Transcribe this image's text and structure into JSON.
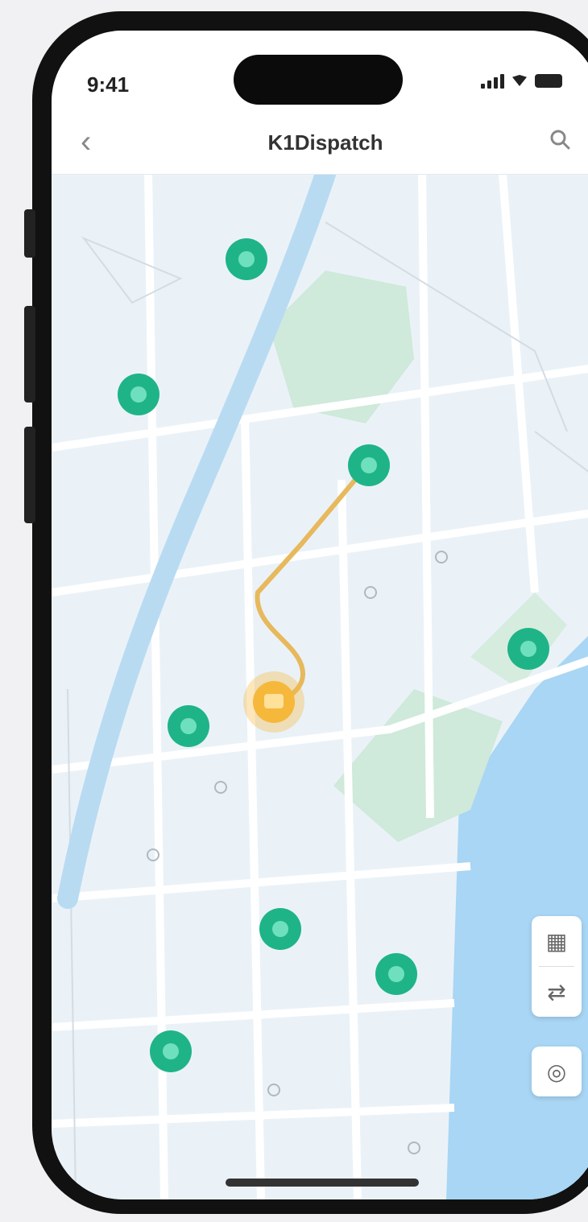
{
  "status_bar": {
    "time": "9:41"
  },
  "header": {
    "title": "K1Dispatch",
    "back_label": "‹"
  },
  "map": {
    "station_color": "#1fb487",
    "vehicle_color": "#f5b83a",
    "route_color": "#e7b95c",
    "water_color": "#a8d6f4",
    "park_color": "#cfe9da",
    "road_color": "#b8dbf2"
  },
  "controls": {
    "layers_icon": "layers-icon",
    "traffic_icon": "traffic-icon",
    "locate_icon": "locate-icon"
  }
}
